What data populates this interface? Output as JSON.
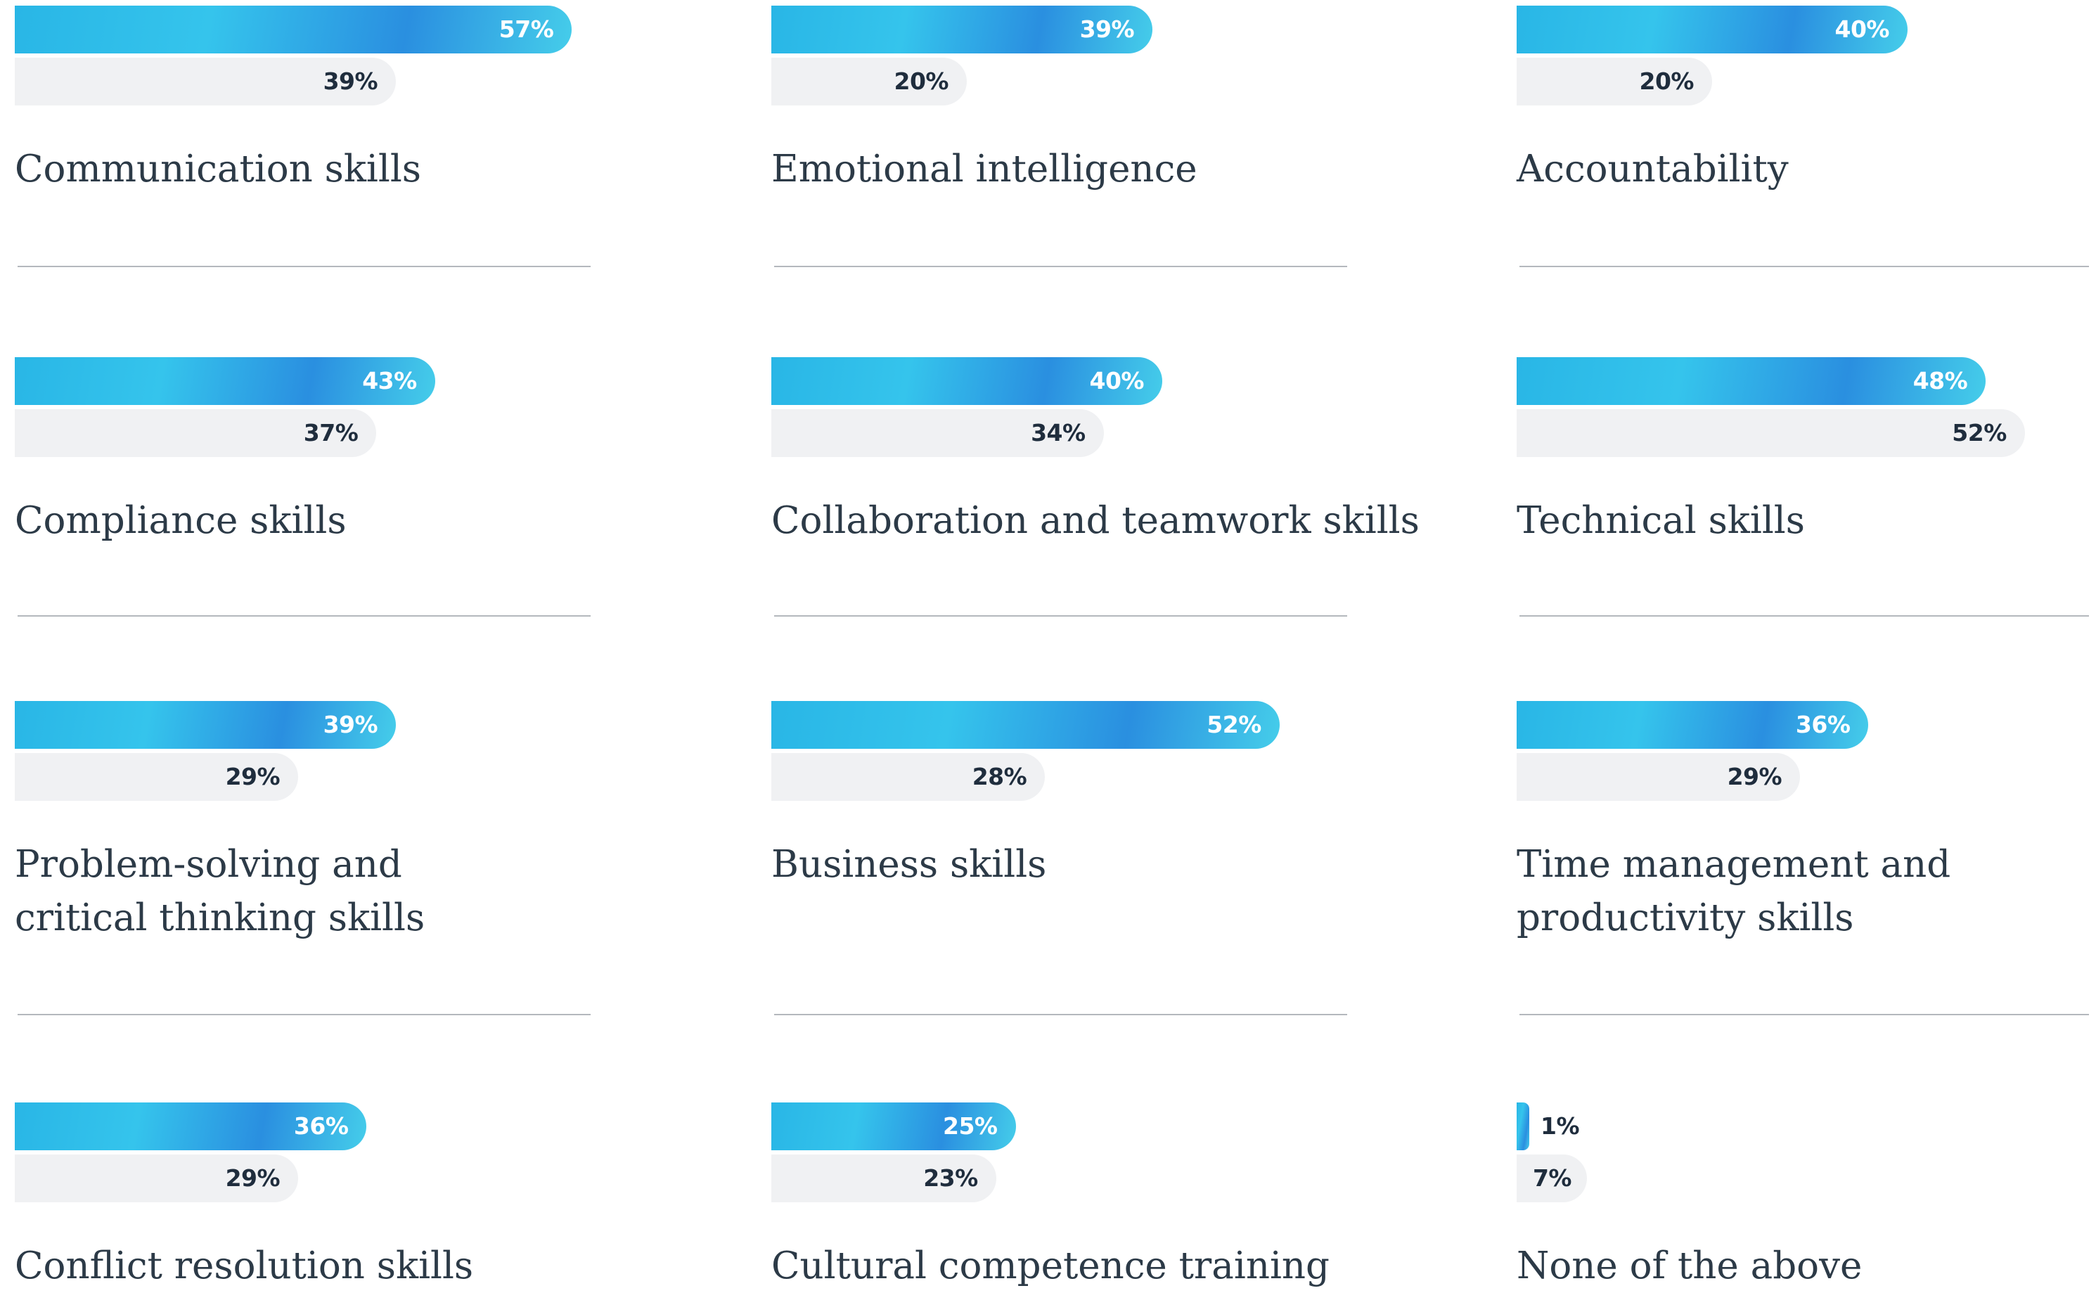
{
  "chart_data": {
    "type": "bar",
    "categories": [
      "Communication skills",
      "Emotional intelligence",
      "Accountability",
      "Compliance skills",
      "Collaboration and teamwork skills",
      "Technical skills",
      "Problem-solving and critical thinking skills",
      "Business skills",
      "Time management and productivity skills",
      "Conflict resolution skills",
      "Cultural competence training",
      "None of the above"
    ],
    "label_lines": [
      [
        "Communication skills"
      ],
      [
        "Emotional intelligence"
      ],
      [
        "Accountability"
      ],
      [
        "Compliance skills"
      ],
      [
        "Collaboration and teamwork skills"
      ],
      [
        "Technical skills"
      ],
      [
        "Problem-solving and",
        "critical thinking skills"
      ],
      [
        "Business skills"
      ],
      [
        "Time management and",
        "productivity skills"
      ],
      [
        "Conflict resolution skills"
      ],
      [
        "Cultural competence training"
      ],
      [
        "None of the above"
      ]
    ],
    "series": [
      {
        "color": "#2aa9e6",
        "values": [
          57,
          39,
          40,
          43,
          40,
          48,
          39,
          52,
          36,
          36,
          25,
          1
        ],
        "labels": [
          "57%",
          "39%",
          "40%",
          "43%",
          "40%",
          "48%",
          "39%",
          "52%",
          "36%",
          "36%",
          "25%",
          "1%"
        ]
      },
      {
        "color": "#f0f1f3",
        "values": [
          39,
          20,
          20,
          37,
          34,
          52,
          29,
          28,
          29,
          29,
          23,
          7
        ],
        "labels": [
          "39%",
          "20%",
          "20%",
          "37%",
          "34%",
          "52%",
          "29%",
          "28%",
          "29%",
          "29%",
          "23%",
          "7%"
        ]
      }
    ],
    "xlim": [
      0,
      100
    ],
    "grid": false,
    "legend": "none"
  }
}
